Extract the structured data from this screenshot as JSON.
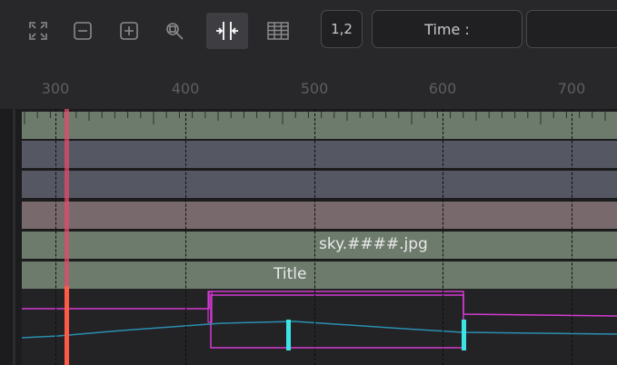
{
  "toolbar": {
    "buttons": [
      {
        "name": "fit-view-icon"
      },
      {
        "name": "zoom-out-icon"
      },
      {
        "name": "zoom-in-icon"
      },
      {
        "name": "zoom-region-icon"
      },
      {
        "name": "split-view-icon",
        "active": true
      },
      {
        "name": "spreadsheet-icon"
      }
    ],
    "frame_toggle_label": "1,2",
    "time_label": "Time :",
    "time_value": ""
  },
  "ruler": {
    "labels": [
      "300",
      "400",
      "500",
      "600",
      "700"
    ]
  },
  "tracks": [
    {
      "kind": "ruler-track",
      "color": "#6d7b6c"
    },
    {
      "kind": "empty",
      "color": "#555763"
    },
    {
      "kind": "empty",
      "color": "#555763"
    },
    {
      "kind": "empty",
      "color": "#786a6c"
    },
    {
      "kind": "clip",
      "color": "#6d7b6c",
      "label": "sky.####.jpg"
    },
    {
      "kind": "clip",
      "color": "#6d7b6c",
      "label": "Title"
    }
  ],
  "colors": {
    "playhead": "#e44a6a",
    "keyframe_box": "#d43bd4",
    "spline_blue": "#2a8fb0",
    "keyframe_marker": "#3ce4e4",
    "graph_bg": "#232325"
  }
}
